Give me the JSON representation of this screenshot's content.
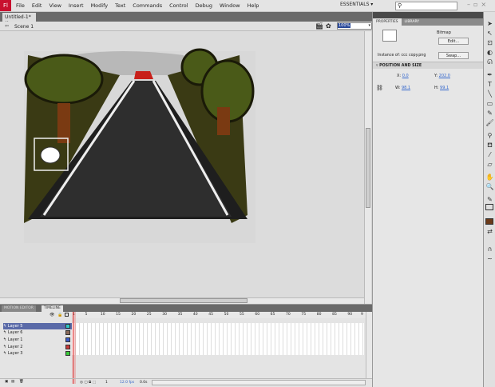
{
  "menubar": {
    "items": [
      "File",
      "Edit",
      "View",
      "Insert",
      "Modify",
      "Text",
      "Commands",
      "Control",
      "Debug",
      "Window",
      "Help"
    ],
    "workspace": "ESSENTIALS ▾"
  },
  "document": {
    "tab": "Untitled-1*",
    "scene": "Scene 1",
    "zoom": "100%"
  },
  "properties": {
    "tabs": [
      "PROPERTIES",
      "LIBRARY"
    ],
    "type": "Bitmap",
    "edit_label": "Edit...",
    "instance_of": "Instance of:  ccc copy.png",
    "swap_label": "Swap...",
    "section": "POSITION AND SIZE",
    "x_label": "X:",
    "x": "0.0",
    "y_label": "Y:",
    "y": "202.0",
    "w_label": "W:",
    "w": "98.1",
    "h_label": "H:",
    "h": "99.1"
  },
  "timeline": {
    "tabs": [
      "MOTION EDITOR",
      "TIMELINE"
    ],
    "ruler": [
      "1",
      "5",
      "10",
      "15",
      "20",
      "25",
      "30",
      "35",
      "40",
      "45",
      "50",
      "55",
      "60",
      "65",
      "70",
      "75",
      "80",
      "85",
      "90",
      "9"
    ],
    "layers": [
      {
        "name": "Layer 5",
        "color": "#2ec4c4",
        "selected": true
      },
      {
        "name": "Layer 6",
        "color": "#8a6a5a"
      },
      {
        "name": "Layer 1",
        "color": "#3a5ac8"
      },
      {
        "name": "Layer 2",
        "color": "#c83a3a"
      },
      {
        "name": "Layer 3",
        "color": "#3ac83a"
      }
    ],
    "frame": "1",
    "fps": "12.0 fps",
    "time": "0.0s"
  },
  "colors": {
    "stroke": "#333333",
    "fill": "#6b3a1a"
  }
}
